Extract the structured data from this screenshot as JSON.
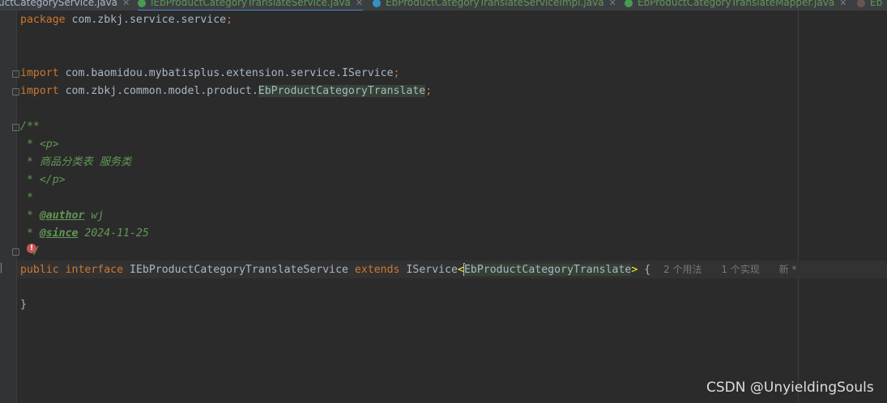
{
  "tabs": [
    {
      "label": "uctCategoryService.java",
      "color": "#a9b7c6",
      "icon": "none",
      "active": false
    },
    {
      "label": "IEbProductCategoryTranslateService.java",
      "color": "#629755",
      "icon": "interface-icon",
      "active": true
    },
    {
      "label": "EbProductCategoryTranslateServiceImpl.java",
      "color": "#629755",
      "icon": "class-icon",
      "active": false
    },
    {
      "label": "EbProductCategoryTranslateMapper.java",
      "color": "#629755",
      "icon": "interface-icon",
      "active": false
    },
    {
      "label": "Eb",
      "color": "#629755",
      "icon": "class-icon",
      "active": false
    }
  ],
  "code": {
    "package_kw": "package",
    "package_name": "com.zbkj.service.service",
    "semicolon": ";",
    "import_kw": "import",
    "import1": "com.baomidou.mybatisplus.extension.service.IService",
    "import2_prefix": "com.zbkj.common.model.product.",
    "import2_class": "EbProductCategoryTranslate",
    "doc_open": "/**",
    "doc_p_open": " * <p>",
    "doc_desc": " * 商品分类表 服务类",
    "doc_p_close": " * </p>",
    "doc_blank": " *",
    "doc_star": " * ",
    "author_tag": "@author",
    "author_val": " wj",
    "since_tag": "@since",
    "since_val": " 2024-11-25",
    "doc_close": " */",
    "public_kw": "public",
    "interface_kw": "interface",
    "iface_name": "IEbProductCategoryTranslateService",
    "extends_kw": "extends",
    "generic_base": "IService",
    "lt": "<",
    "generic_arg": "EbProductCategoryTranslate",
    "gt": ">",
    "open_brace": " {",
    "close_brace": "}"
  },
  "inlay_hints": {
    "usages": "2 个用法",
    "impls": "1 个实现",
    "new": "新 *"
  },
  "watermark": "CSDN @UnyieldingSouls"
}
